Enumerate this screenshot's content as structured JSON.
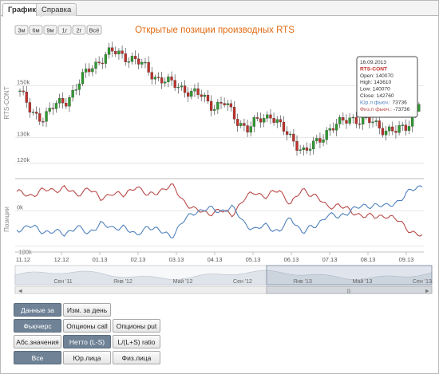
{
  "tabs": [
    {
      "label": "График",
      "active": true
    },
    {
      "label": "Справка",
      "active": false
    }
  ],
  "zoom_buttons": [
    "3м",
    "6м",
    "9м",
    "1г",
    "2г",
    "Всё"
  ],
  "colors": {
    "up": "#2e9a2e",
    "down": "#c0302a",
    "title": "#e06a12",
    "phys": "#b94a48",
    "legal": "#4f81bd"
  },
  "tooltip": {
    "date": "16.09.2013",
    "ticker": "RTS-CONT",
    "open": "Open: 140070",
    "high": "High: 143610",
    "low": "Low: 140070",
    "close": "Close: 142760",
    "legal_label": "Юр.л фьюч.: ",
    "legal_value": "73736",
    "phys_label": "Физ.л фьюч.: ",
    "phys_value": "-73736"
  },
  "chart_data": [
    {
      "type": "candlestick",
      "title": "Открытые позиции производных RTS",
      "ylabel": "RTS-CONT",
      "ylim": [
        115000,
        168000
      ],
      "yticks": [
        "120k",
        "130k",
        "150k"
      ],
      "x_tick_labels": [
        "11.12",
        "12.12",
        "01.13",
        "02.13",
        "03.13",
        "04.13",
        "05.13",
        "06.13",
        "07.13",
        "08.13",
        "09.13"
      ],
      "close_path": [
        148000,
        139000,
        138000,
        142000,
        144000,
        150000,
        156000,
        160000,
        163000,
        162000,
        160000,
        157000,
        153000,
        151000,
        150000,
        147000,
        146000,
        142000,
        143000,
        137000,
        133000,
        137000,
        139000,
        133000,
        129000,
        124000,
        128000,
        133000,
        135000,
        138000,
        136000,
        136000,
        133000,
        132000,
        135000,
        142760
      ],
      "last_candle": {
        "open": 140070,
        "high": 143610,
        "low": 140070,
        "close": 142760
      }
    },
    {
      "type": "line",
      "ylabel": "Позиции",
      "yticks": [
        "0k",
        "-100k"
      ],
      "series": [
        {
          "name": "Физ.л фьюч.",
          "color": "#b94a48",
          "values": [
            55,
            40,
            60,
            55,
            70,
            40,
            70,
            30,
            55,
            40,
            75,
            40,
            60,
            70,
            30,
            0,
            -5,
            0,
            -10,
            30,
            55,
            40,
            60,
            20,
            60,
            45,
            10,
            20,
            -5,
            -10,
            -20,
            -10,
            -30,
            -55,
            -74
          ]
        },
        {
          "name": "Юр.л фьюч.",
          "color": "#4f81bd",
          "values": [
            -55,
            -40,
            -60,
            -55,
            -70,
            -40,
            -70,
            -30,
            -55,
            -40,
            -75,
            -40,
            -60,
            -70,
            -30,
            0,
            5,
            0,
            10,
            -30,
            -55,
            -40,
            -60,
            -20,
            -60,
            -45,
            -10,
            -20,
            5,
            10,
            20,
            10,
            30,
            55,
            74
          ]
        }
      ]
    }
  ],
  "navigator_labels": [
    "Сен '11",
    "Янв '12",
    "Май '12",
    "Сен '12",
    "Янв '13",
    "Май '13",
    "Сен '13"
  ],
  "controls": {
    "row1": [
      {
        "label": "Данные за день",
        "on": true
      },
      {
        "label": "Изм. за день",
        "on": false
      }
    ],
    "row2": [
      {
        "label": "Фьючерс",
        "on": true
      },
      {
        "label": "Опционы call",
        "on": false
      },
      {
        "label": "Опционы put",
        "on": false
      }
    ],
    "row3": [
      {
        "label": "Абс.значения",
        "on": false
      },
      {
        "label": "Нетто (L-S)",
        "on": true
      },
      {
        "label": "L/(L+S) ratio",
        "on": false
      }
    ],
    "row4": [
      {
        "label": "Все",
        "on": true
      },
      {
        "label": "Юр.лица",
        "on": false
      },
      {
        "label": "Физ.лица",
        "on": false
      }
    ]
  }
}
